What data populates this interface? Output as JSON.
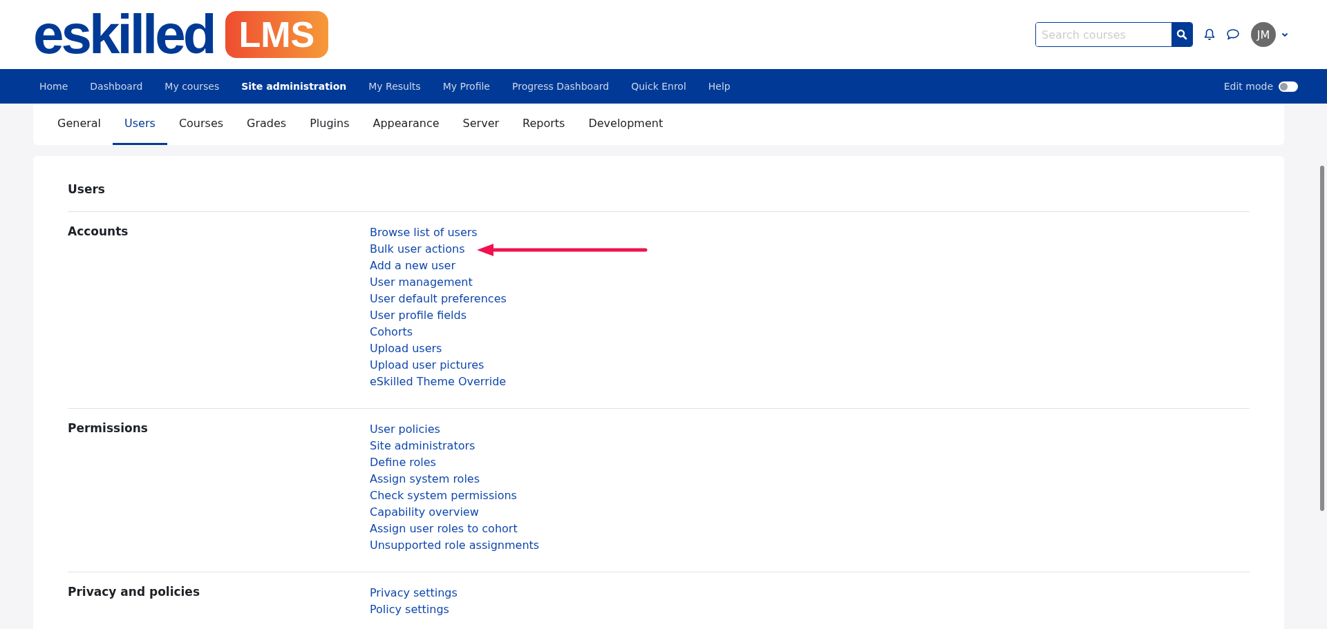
{
  "header": {
    "logo_word": "eskilled",
    "logo_badge": "LMS",
    "search": {
      "placeholder": "Search courses"
    },
    "avatar_initials": "JM"
  },
  "nav": {
    "items": [
      {
        "label": "Home",
        "selected": false
      },
      {
        "label": "Dashboard",
        "selected": false
      },
      {
        "label": "My courses",
        "selected": false
      },
      {
        "label": "Site administration",
        "selected": true
      },
      {
        "label": "My Results",
        "selected": false
      },
      {
        "label": "My Profile",
        "selected": false
      },
      {
        "label": "Progress Dashboard",
        "selected": false
      },
      {
        "label": "Quick Enrol",
        "selected": false
      },
      {
        "label": "Help",
        "selected": false
      }
    ],
    "edit_mode": {
      "label": "Edit mode",
      "on": false
    }
  },
  "tabs": [
    {
      "label": "General",
      "selected": false
    },
    {
      "label": "Users",
      "selected": true
    },
    {
      "label": "Courses",
      "selected": false
    },
    {
      "label": "Grades",
      "selected": false
    },
    {
      "label": "Plugins",
      "selected": false
    },
    {
      "label": "Appearance",
      "selected": false
    },
    {
      "label": "Server",
      "selected": false
    },
    {
      "label": "Reports",
      "selected": false
    },
    {
      "label": "Development",
      "selected": false
    }
  ],
  "page_heading": "Users",
  "sections": [
    {
      "title": "Accounts",
      "links": [
        "Browse list of users",
        "Bulk user actions",
        "Add a new user",
        "User management",
        "User default preferences",
        "User profile fields",
        "Cohorts",
        "Upload users",
        "Upload user pictures",
        "eSkilled Theme Override"
      ]
    },
    {
      "title": "Permissions",
      "links": [
        "User policies",
        "Site administrators",
        "Define roles",
        "Assign system roles",
        "Check system permissions",
        "Capability overview",
        "Assign user roles to cohort",
        "Unsupported role assignments"
      ]
    },
    {
      "title": "Privacy and policies",
      "links": [
        "Privacy settings",
        "Policy settings"
      ]
    }
  ]
}
